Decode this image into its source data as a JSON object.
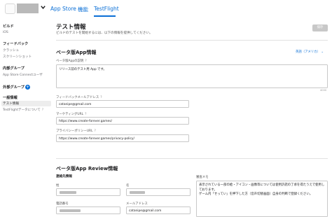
{
  "header": {
    "tabs": [
      {
        "label": "App Store"
      },
      {
        "label": "機能"
      },
      {
        "label": "TestFlight"
      }
    ]
  },
  "sidebar": {
    "build_heading": "ビルド",
    "build_items": [
      "iOS"
    ],
    "feedback_heading": "フィードバック",
    "feedback_items": [
      "クラッシュ",
      "スクリーンショット"
    ],
    "internal_heading": "内部グループ",
    "internal_items": [
      "App Store Connectユーザ"
    ],
    "external_heading": "外部グループ",
    "general_heading": "一般情報",
    "general_items": [
      "テスト情報",
      "TestFlightデータについて"
    ]
  },
  "main": {
    "title": "テスト情報",
    "subtitle": "ビルドのテストを開始するには、以下の情報を提供してください。",
    "save_label": "保存",
    "beta_section_title": "ベータ版App情報",
    "language_label": "英語（アメリカ）",
    "description_label": "ベータ版Appの説明",
    "description_value": "リリース前のテスト用 App です。",
    "description_counter": "4000",
    "feedback_email_label": "フィードバックメールアドレス",
    "feedback_email_value": "catanipe@gmail.com",
    "marketing_url_label": "マーケティングURL",
    "marketing_url_value": "https://www.create-forever.games/",
    "privacy_url_label": "プライバシーポリシーURL",
    "privacy_url_value": "https://www.create-forever.games/privacy-policy/",
    "review_section_title": "ベータ版App Review情報",
    "contact_heading": "連絡先情報",
    "last_name_label": "姓",
    "first_name_label": "名",
    "phone_label": "電話番号",
    "email_label": "メールアドレス",
    "email_value": "catanipe@gmail.com",
    "notes_label": "審査メモ",
    "notes_value_1": "表示されている一部の絵・アイコン・画像等については使用許諾の了承を得たうえで使用しております。",
    "notes_value_2": "ゲーム内「せってい」を押下した方（音声切替画面）自身の判断で登録ください。"
  },
  "colors": {
    "accent": "#0a6fd6",
    "save_disabled": "#c8c8c8",
    "redaction": "#bdbdbd"
  }
}
